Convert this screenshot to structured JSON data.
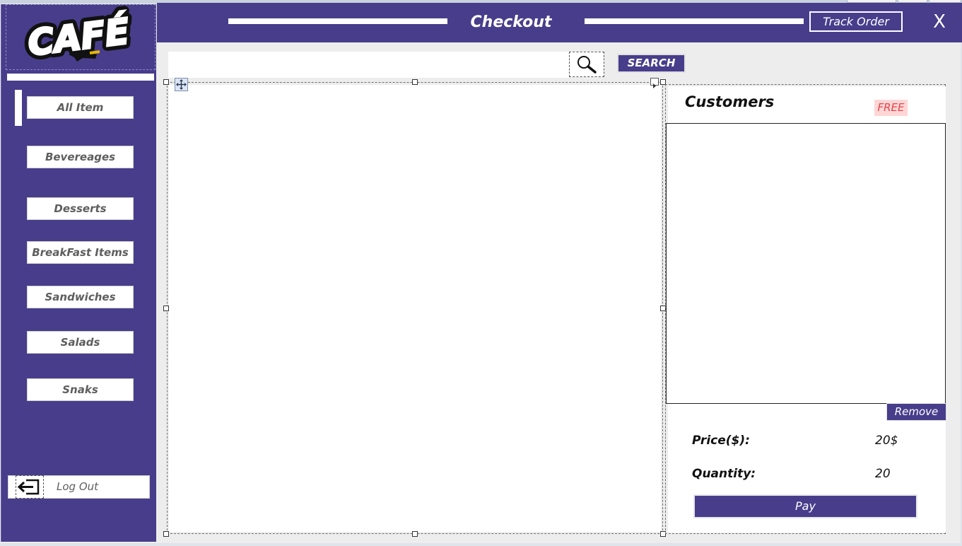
{
  "app": {
    "logo_text": "CAFÉ",
    "title": "Checkout",
    "track_order_label": "Track Order",
    "close_label": "X",
    "brand_color": "#483d8b"
  },
  "sidebar": {
    "items": [
      {
        "label": "All Item"
      },
      {
        "label": "Bevereages"
      },
      {
        "label": "Desserts"
      },
      {
        "label": "BreakFast Items"
      },
      {
        "label": "Sandwiches"
      },
      {
        "label": "Salads"
      },
      {
        "label": "Snaks"
      }
    ],
    "logout_label": "Log Out"
  },
  "search": {
    "value": "",
    "button_label": "SEARCH"
  },
  "customers": {
    "title": "Customers",
    "badge": "FREE",
    "remove_label": "Remove"
  },
  "summary": {
    "price_label": "Price($):",
    "price_value": "20$",
    "quantity_label": "Quantity:",
    "quantity_value": "20",
    "pay_label": "Pay"
  }
}
